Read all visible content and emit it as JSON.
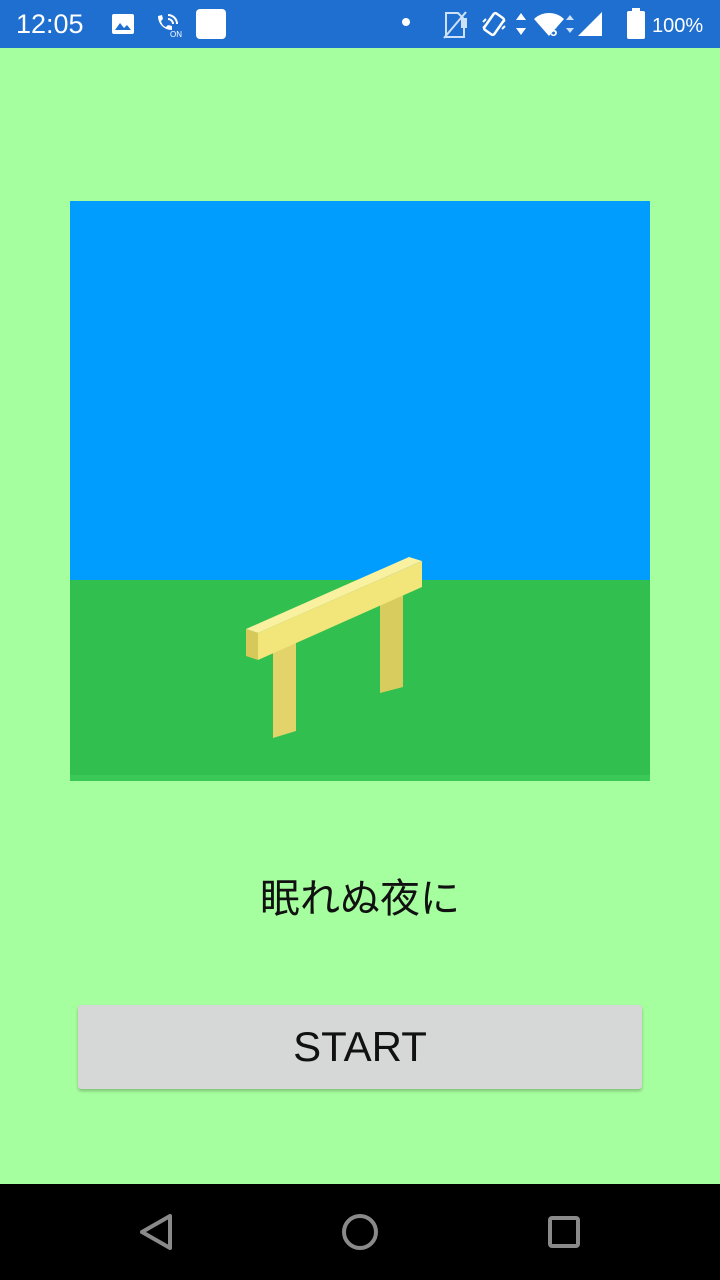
{
  "status_bar": {
    "time": "12:05",
    "battery_percent": "100%",
    "icons": [
      "image-icon",
      "wifi-calling-on-icon",
      "app-notification-icon",
      "notification-dot-icon",
      "no-sim-icon",
      "vibrate-icon",
      "data-arrows-icon",
      "wifi-5-icon",
      "cell-signal-icon",
      "battery-full-icon"
    ],
    "color": "#1e6fd0"
  },
  "scene": {
    "sky_color": "#009dff",
    "grass_color": "#31c04f",
    "hurdle_color": "#f2e57a"
  },
  "title": "眠れぬ夜に",
  "start_button": {
    "label": "START"
  },
  "nav_bar": {
    "icons": [
      "back-icon",
      "home-icon",
      "recents-icon"
    ]
  },
  "background_color": "#a6ff9e"
}
